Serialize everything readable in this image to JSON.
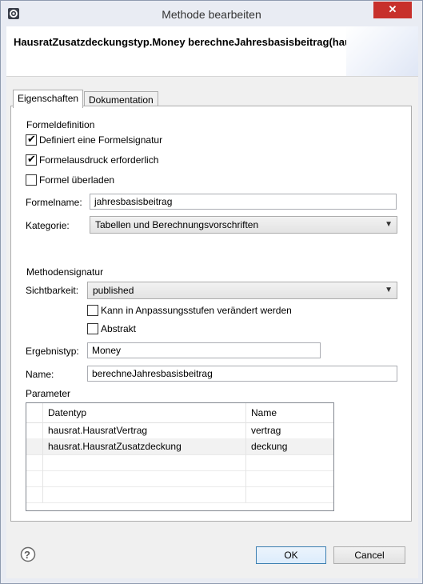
{
  "window": {
    "title": "Methode bearbeiten",
    "close_glyph": "✕"
  },
  "header": {
    "title": "HausratZusatzdeckungstyp.Money berechneJahresbasisbeitrag(hausrat"
  },
  "tabs": [
    {
      "label": "Eigenschaften",
      "active": true
    },
    {
      "label": "Dokumentation",
      "active": false
    }
  ],
  "formula": {
    "section_label": "Formeldefinition",
    "checkbox_signature": {
      "label": "Definiert eine Formelsignatur",
      "checked": true
    },
    "checkbox_required": {
      "label": "Formelausdruck erforderlich",
      "checked": true
    },
    "checkbox_overload": {
      "label": "Formel überladen",
      "checked": false
    },
    "name_label": "Formelname:",
    "name_value": "jahresbasisbeitrag",
    "category_label": "Kategorie:",
    "category_value": "Tabellen und Berechnungsvorschriften"
  },
  "signature": {
    "section_label": "Methodensignatur",
    "visibility_label": "Sichtbarkeit:",
    "visibility_value": "published",
    "checkbox_changeable": {
      "label": "Kann in Anpassungsstufen verändert werden",
      "checked": false
    },
    "checkbox_abstract": {
      "label": "Abstrakt",
      "checked": false
    },
    "result_label": "Ergebnistyp:",
    "result_value": "Money",
    "name_label": "Name:",
    "name_value": "berechneJahresbasisbeitrag",
    "params_label": "Parameter"
  },
  "params_table": {
    "columns": [
      "Datentyp",
      "Name"
    ],
    "rows": [
      {
        "type": "hausrat.HausratVertrag",
        "name": "vertrag"
      },
      {
        "type": "hausrat.HausratZusatzdeckung",
        "name": "deckung"
      }
    ]
  },
  "buttons": {
    "ok": "OK",
    "cancel": "Cancel",
    "help": "?"
  },
  "check_glyph": "✔",
  "dropdown_glyph": "▼"
}
